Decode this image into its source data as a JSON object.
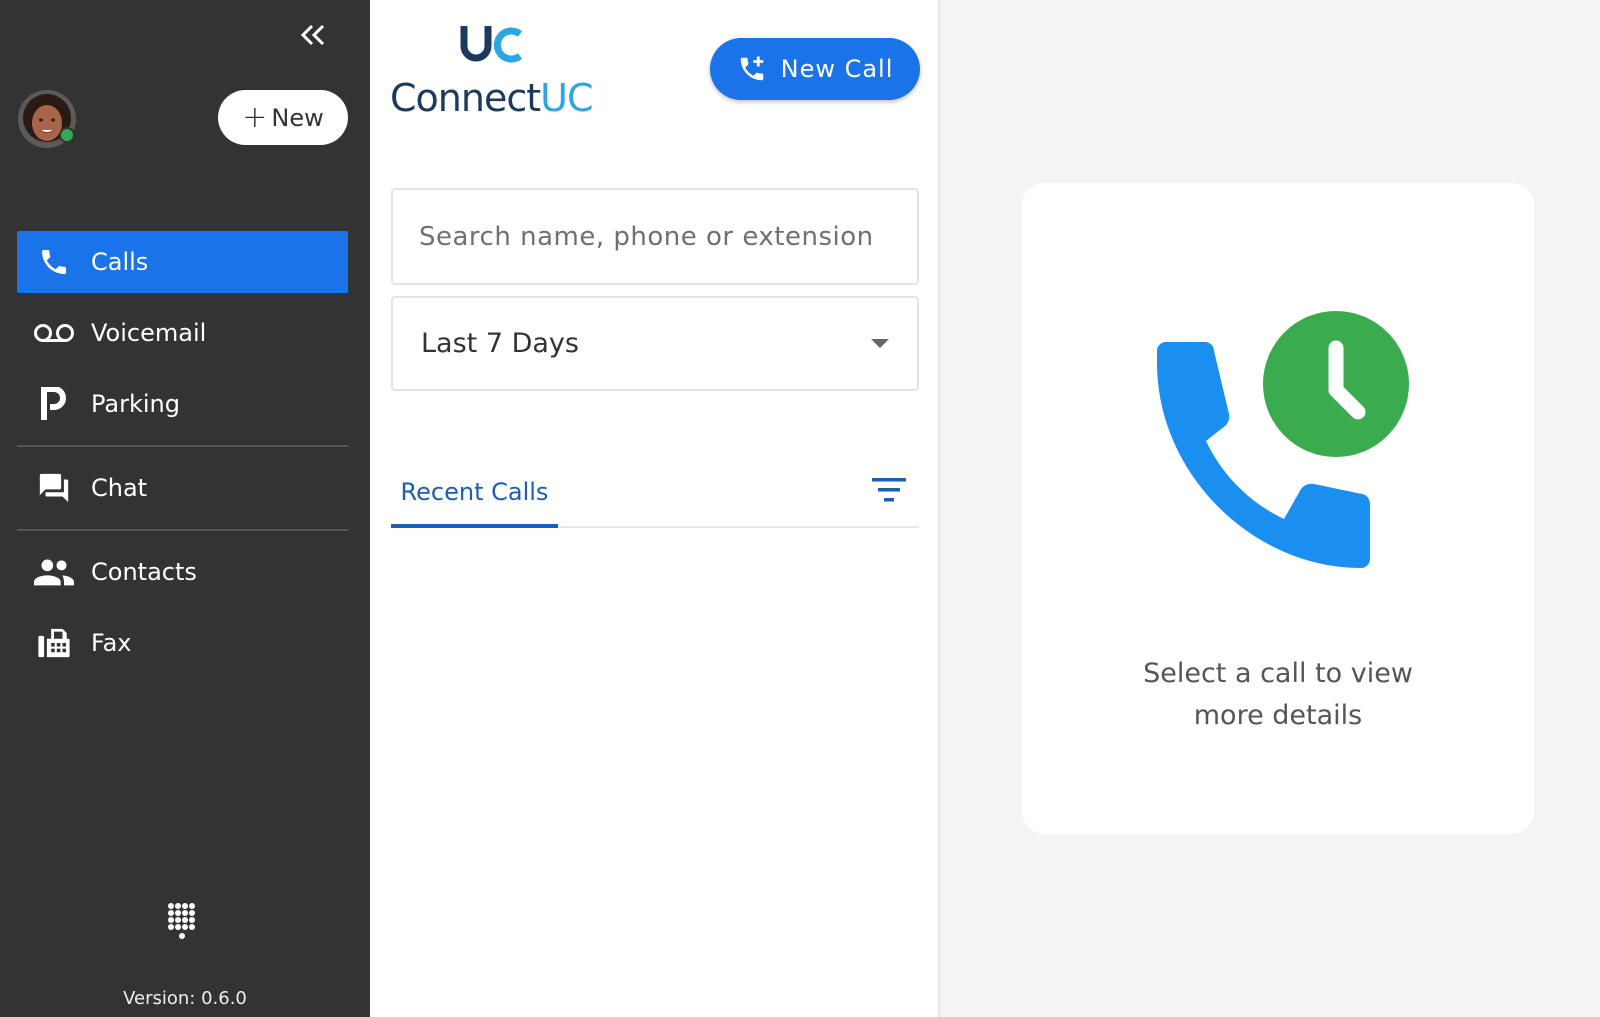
{
  "sidebar": {
    "collapse_icon": "double-chevron-left-icon",
    "new_button_label": "New",
    "user_status": "online",
    "nav": [
      {
        "label": "Calls",
        "icon": "phone-icon",
        "active": true
      },
      {
        "label": "Voicemail",
        "icon": "voicemail-icon",
        "active": false
      },
      {
        "label": "Parking",
        "icon": "parking-icon",
        "active": false
      },
      {
        "label": "Chat",
        "icon": "chat-icon",
        "active": false
      },
      {
        "label": "Contacts",
        "icon": "contacts-icon",
        "active": false
      },
      {
        "label": "Fax",
        "icon": "fax-icon",
        "active": false
      }
    ],
    "version": "Version: 0.6.0"
  },
  "header": {
    "logo_text_a": "Connect",
    "logo_text_b": "UC",
    "new_call_label": "New Call"
  },
  "search": {
    "placeholder": "Search name, phone or extension",
    "value": ""
  },
  "range_select": {
    "selected": "Last 7 Days"
  },
  "tabs": [
    {
      "label": "Recent Calls",
      "active": true
    }
  ],
  "details": {
    "empty_line1": "Select a call to view",
    "empty_line2": "more details"
  },
  "colors": {
    "primary": "#1a73e8",
    "sidebar_bg": "#333333",
    "online": "#34a853",
    "phone_blue": "#1b8fef",
    "clock_green": "#3bab50"
  }
}
